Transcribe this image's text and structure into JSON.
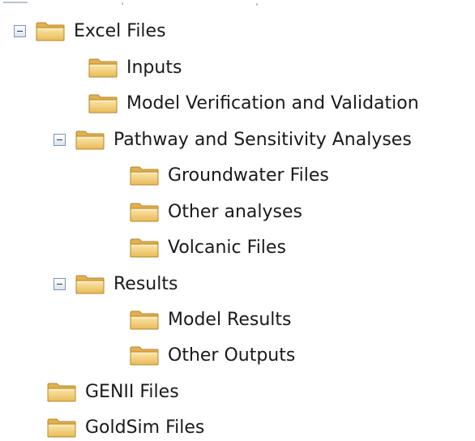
{
  "tree": {
    "root": {
      "label": "Excel Files",
      "children": {
        "inputs": {
          "label": "Inputs"
        },
        "model_vv": {
          "label": "Model Verification and Validation"
        },
        "pathway": {
          "label": "Pathway and Sensitivity Analyses",
          "children": {
            "groundwater": {
              "label": "Groundwater Files"
            },
            "other_analyses": {
              "label": "Other analyses"
            },
            "volcanic": {
              "label": "Volcanic Files"
            }
          }
        },
        "results": {
          "label": "Results",
          "children": {
            "model_results": {
              "label": "Model Results"
            },
            "other_outputs": {
              "label": "Other Outputs"
            }
          }
        }
      }
    },
    "genii": {
      "label": "GENII Files"
    },
    "goldsim": {
      "label": "GoldSim Files"
    }
  },
  "icons": {
    "toggle": "collapse-minus-icon",
    "folder": "folder-icon"
  },
  "colors": {
    "folder_fill": "#f2cf7a",
    "folder_edge": "#c99a3a",
    "toggle_border": "#7c96b8",
    "text": "#1a1a1a"
  }
}
